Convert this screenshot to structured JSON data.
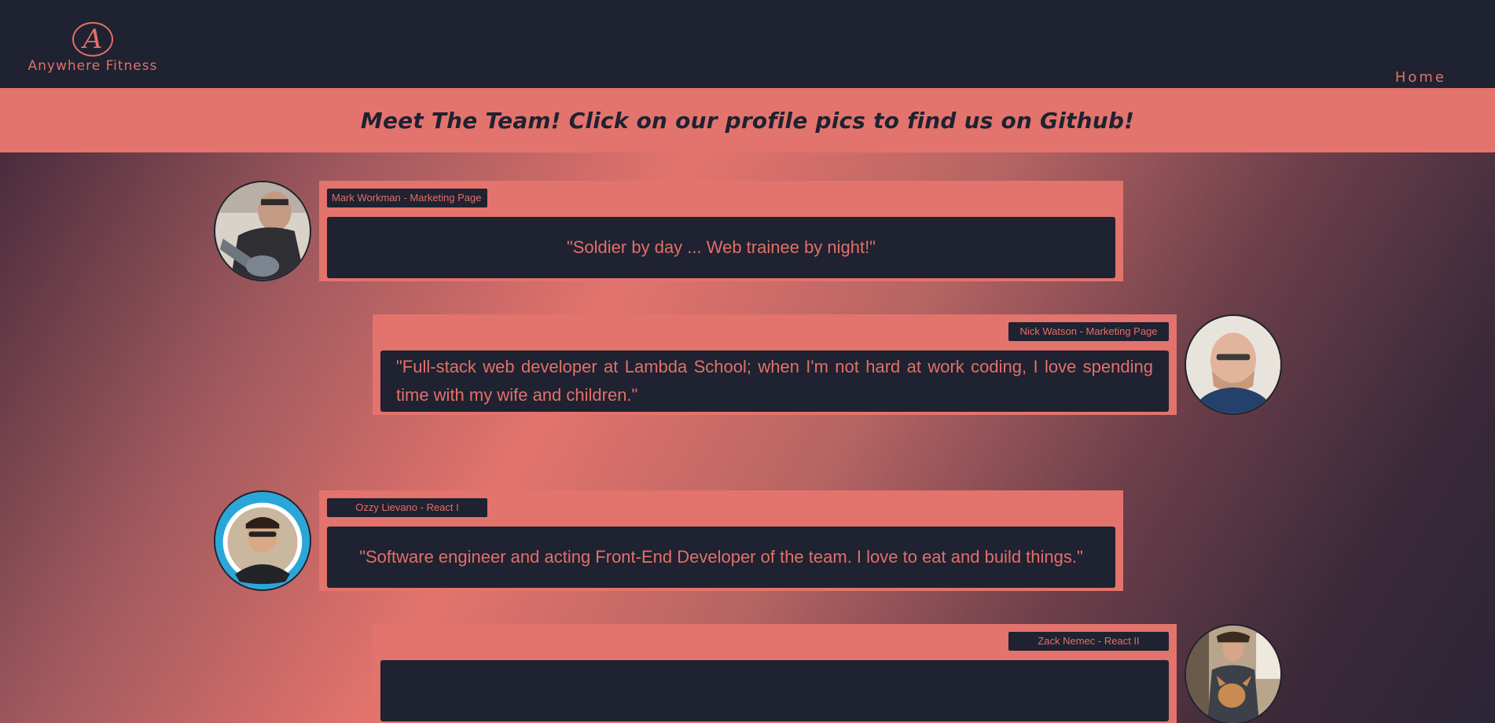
{
  "header": {
    "logo_letter": "A",
    "logo_text": "Anywhere Fitness",
    "nav_home": "Home"
  },
  "banner": {
    "title": "Meet The Team! Click on our profile pics to find us on Github!"
  },
  "colors": {
    "dark": "#1f2230",
    "accent": "#e3736d"
  },
  "team": [
    {
      "name_role": "Mark Workman - Marketing Page",
      "quote": "\"Soldier by day ... Web trainee by night!\""
    },
    {
      "name_role": "Nick Watson - Marketing Page",
      "quote": "\"Full-stack web developer at Lambda School; when I'm not hard at work coding, I love spending time with my wife and children.\""
    },
    {
      "name_role": "Ozzy Lievano - React I",
      "quote": "\"Software engineer and acting Front-End Developer of the team. I love to eat and build things.\""
    },
    {
      "name_role": "Zack Nemec - React II",
      "quote": ""
    }
  ]
}
